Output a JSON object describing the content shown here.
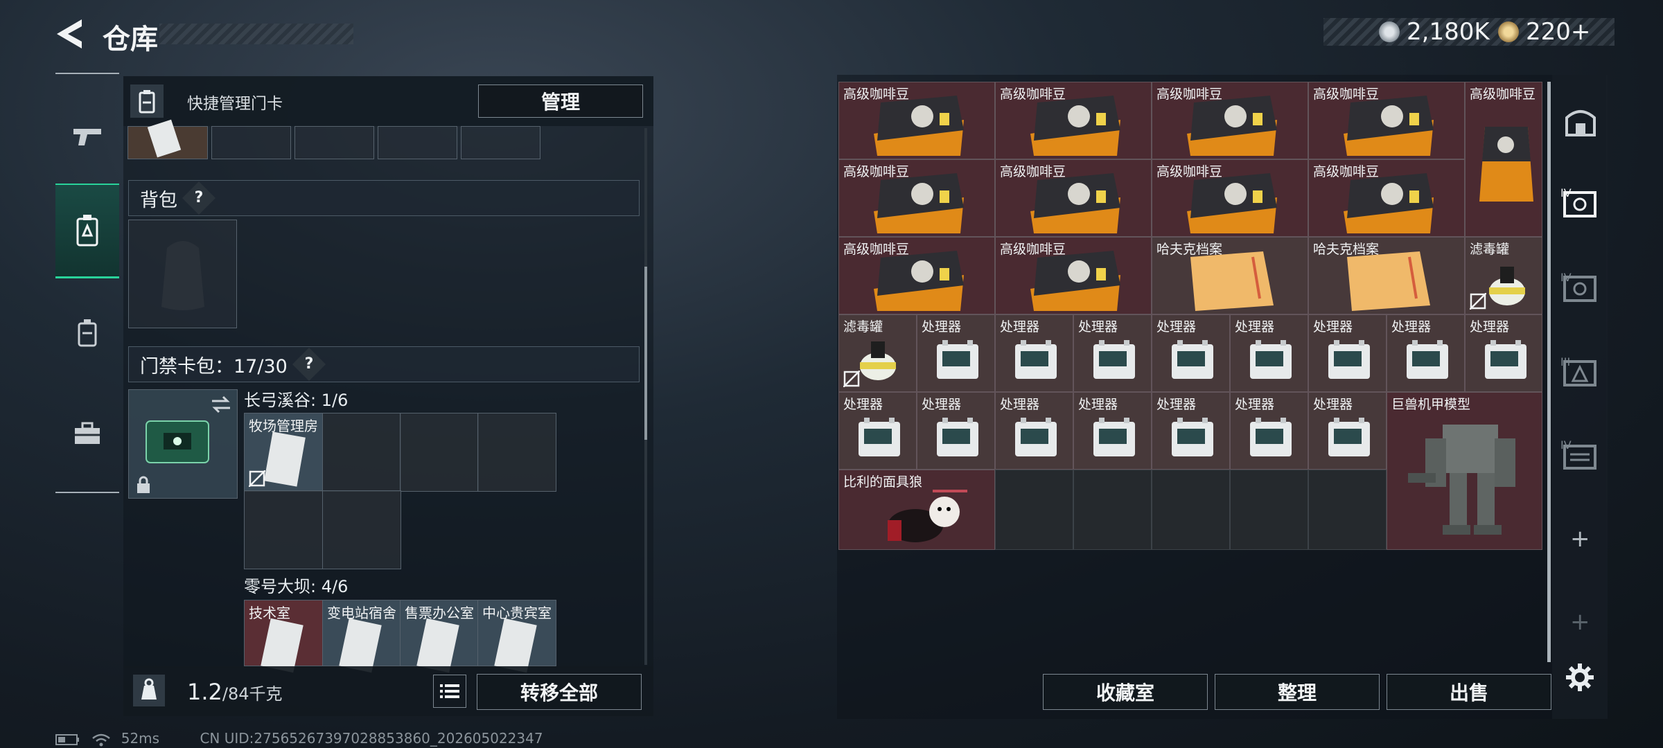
{
  "header": {
    "title": "仓库",
    "currency": [
      {
        "name": "coin-icon",
        "value": "2,180K"
      },
      {
        "name": "token-icon",
        "value": "220+"
      }
    ]
  },
  "keycard_manage": {
    "label": "快捷管理门卡",
    "button": "管理"
  },
  "backpack": {
    "label": "背包"
  },
  "keycard_pack": {
    "label": "门禁卡包：17/30"
  },
  "zone1": {
    "label": "长弓溪谷: 1/6",
    "cards": [
      "牧场管理房"
    ]
  },
  "zone2": {
    "label": "零号大坝: 4/6",
    "cards": [
      "技术室",
      "变电站宿舍",
      "售票办公室",
      "中心贵宾室"
    ]
  },
  "footer": {
    "weight_value": "1.2",
    "weight_cap": "/84千克",
    "transfer_all": "转移全部"
  },
  "stash_items": [
    "高级咖啡豆",
    "高级咖啡豆",
    "高级咖啡豆",
    "高级咖啡豆",
    "高级咖啡豆",
    "高级咖啡豆",
    "高级咖啡豆",
    "高级咖啡豆",
    "高级咖啡豆",
    "高级咖啡豆",
    "高级咖啡豆",
    "哈夫克档案",
    "哈夫克档案",
    "滤毒罐",
    "滤毒罐",
    "处理器",
    "处理器",
    "处理器",
    "处理器",
    "处理器",
    "处理器",
    "处理器",
    "处理器",
    "处理器",
    "处理器",
    "处理器",
    "处理器",
    "处理器",
    "处理器",
    "处理器",
    "巨兽机甲模型",
    "比利的面具狼"
  ],
  "bottom_buttons": [
    "收藏室",
    "整理",
    "出售"
  ],
  "status": {
    "ping": "52ms",
    "uid": "CN UID:2756526739702885386­0_202605022347"
  },
  "colors": {
    "accent": "#29d39a",
    "item_red": "#4a2a31",
    "item_brown": "#47393a"
  }
}
